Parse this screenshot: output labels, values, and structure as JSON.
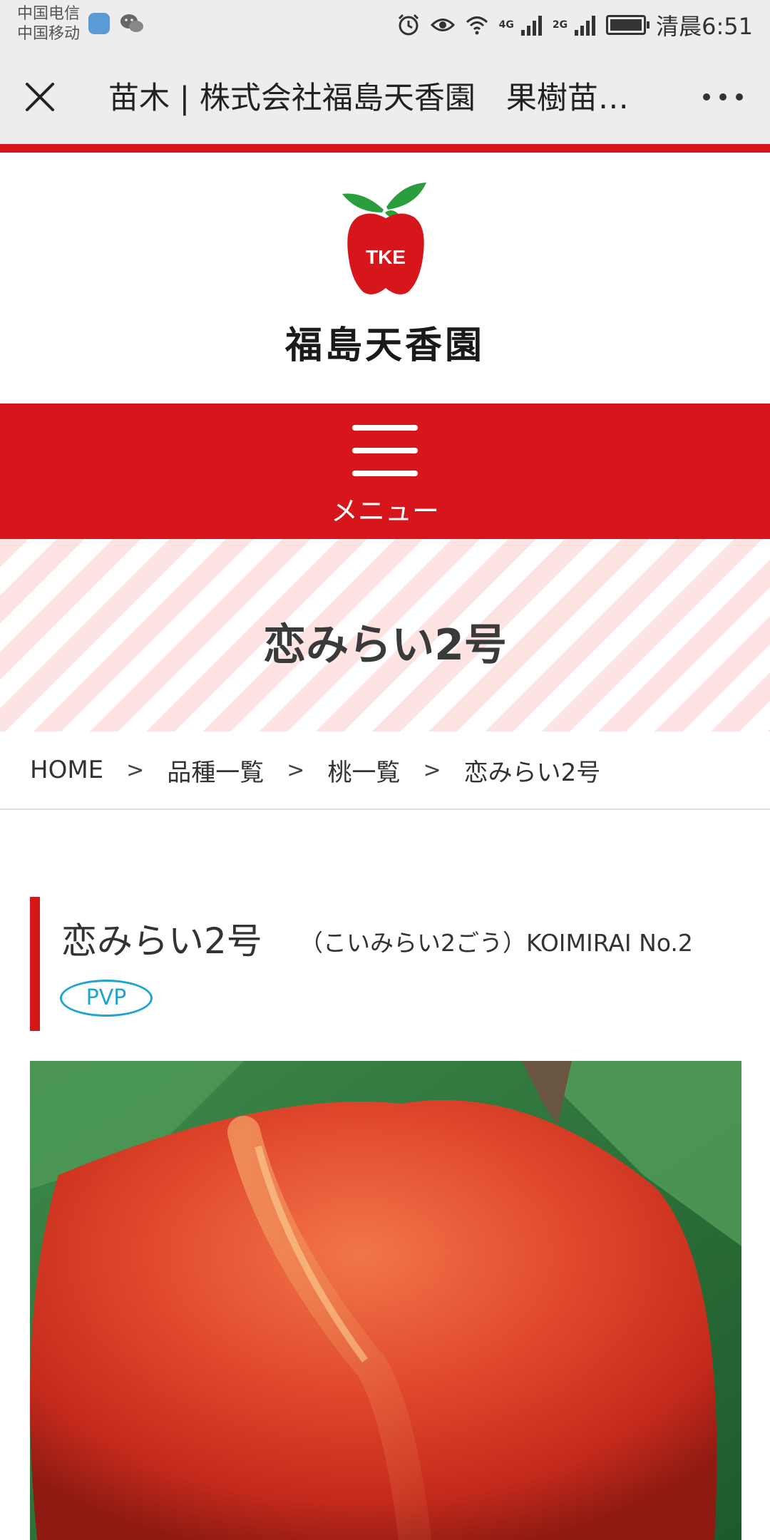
{
  "status_bar": {
    "carrier_1": "中国电信",
    "carrier_2": "中国移动",
    "net_1": "4G",
    "net_2": "2G",
    "time": "清晨6:51"
  },
  "nav": {
    "title": "苗木 | 株式会社福島天香園　果樹苗…"
  },
  "site": {
    "logo_badge": "TKE",
    "brand_name": "福島天香園",
    "menu_label": "メニュー"
  },
  "page": {
    "title": "恋みらい2号"
  },
  "breadcrumb": [
    "HOME",
    "品種一覧",
    "桃一覧",
    "恋みらい2号"
  ],
  "breadcrumb_separator": ">",
  "product": {
    "name": "恋みらい2号",
    "reading": "（こいみらい2ごう）KOIMIRAI No.2",
    "badge": "PVP"
  },
  "colors": {
    "brand_red": "#d6161b",
    "badge_blue": "#21a3d4",
    "stripe_pink": "#fde3e2"
  }
}
